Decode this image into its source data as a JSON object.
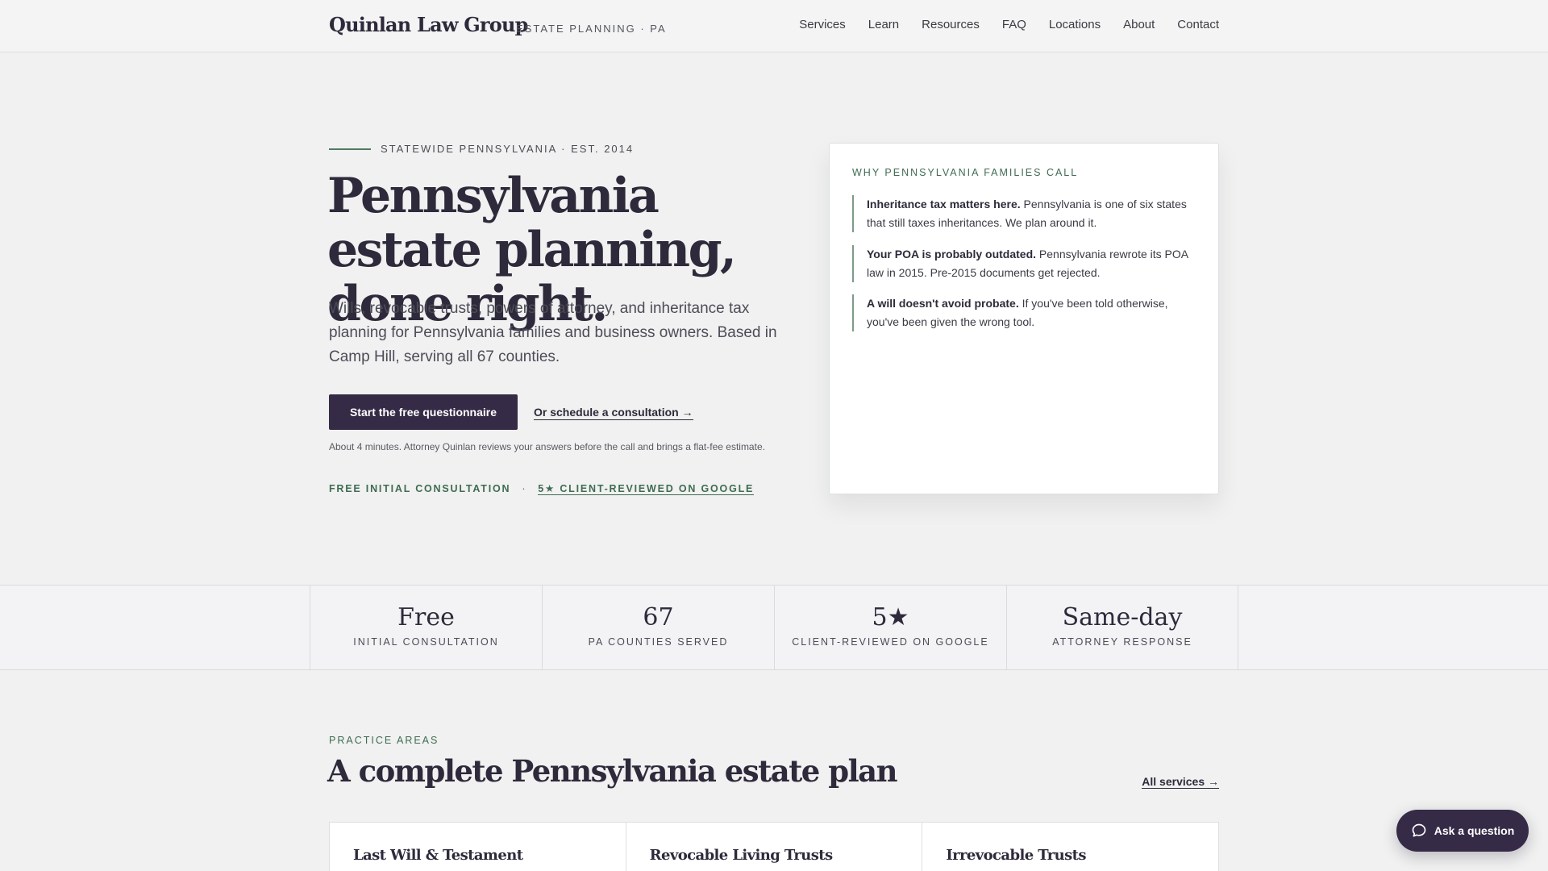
{
  "header": {
    "brand": "Quinlan Law Group",
    "tagline": "ESTATE PLANNING · PA",
    "nav": [
      "Services",
      "Learn",
      "Resources",
      "FAQ",
      "Locations",
      "About",
      "Contact"
    ]
  },
  "hero": {
    "eyebrow": "STATEWIDE PENNSYLVANIA · EST. 2014",
    "title": "Pennsylvania estate planning, done right.",
    "subtitle": "Wills, revocable trusts, powers of attorney, and inheritance tax planning for Pennsylvania families and business owners. Based in Camp Hill, serving all 67 counties.",
    "cta_primary": "Start the free questionnaire",
    "cta_secondary": "Or schedule a consultation →",
    "cta_note": "About 4 minutes. Attorney Quinlan reviews your answers before the call and brings a flat-fee estimate.",
    "trust_a": "FREE INITIAL CONSULTATION",
    "trust_sep": "·",
    "trust_b": "5★ CLIENT-REVIEWED ON GOOGLE"
  },
  "card": {
    "eyebrow": "WHY PENNSYLVANIA FAMILIES CALL",
    "items": [
      {
        "bold": "Inheritance tax matters here.",
        "text": " Pennsylvania is one of six states that still taxes inheritances. We plan around it."
      },
      {
        "bold": "Your POA is probably outdated.",
        "text": " Pennsylvania rewrote its POA law in 2015. Pre-2015 documents get rejected."
      },
      {
        "bold": "A will doesn't avoid probate.",
        "text": " If you've been told otherwise, you've been given the wrong tool."
      }
    ]
  },
  "stats": [
    {
      "value": "Free",
      "label": "INITIAL CONSULTATION"
    },
    {
      "value": "67",
      "label": "PA COUNTIES SERVED"
    },
    {
      "value": "5★",
      "label": "CLIENT-REVIEWED ON GOOGLE"
    },
    {
      "value": "Same-day",
      "label": "ATTORNEY RESPONSE"
    }
  ],
  "practice": {
    "eyebrow": "PRACTICE AREAS",
    "title": "A complete Pennsylvania estate plan",
    "all_link": "All services →",
    "cards": [
      "Last Will & Testament",
      "Revocable Living Trusts",
      "Irrevocable Trusts"
    ]
  },
  "chat": {
    "label": "Ask a question",
    "icon": "chat-bubble-icon"
  },
  "colors": {
    "primary": "#352b47",
    "accent_green": "#3f6b52",
    "background": "#f0f1f0"
  }
}
